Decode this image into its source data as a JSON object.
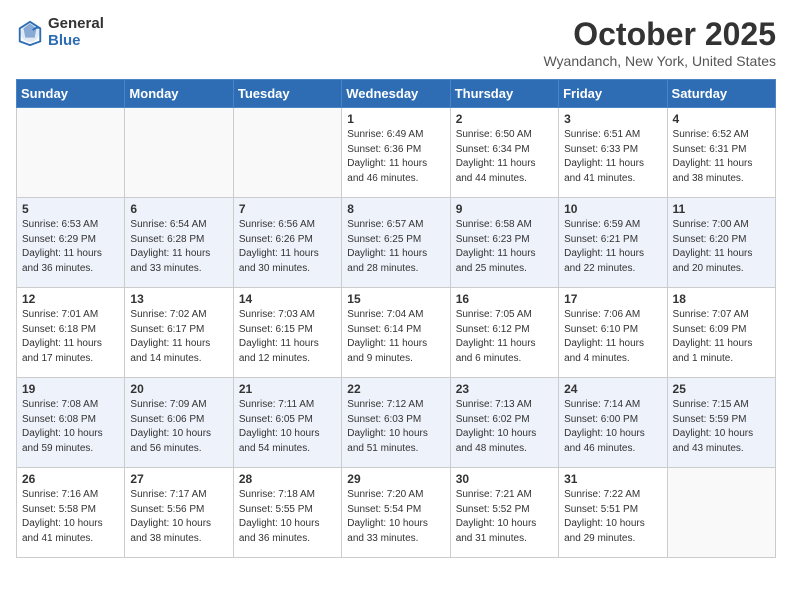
{
  "logo": {
    "general": "General",
    "blue": "Blue"
  },
  "title": "October 2025",
  "location": "Wyandanch, New York, United States",
  "days_of_week": [
    "Sunday",
    "Monday",
    "Tuesday",
    "Wednesday",
    "Thursday",
    "Friday",
    "Saturday"
  ],
  "weeks": [
    [
      {
        "day": "",
        "info": ""
      },
      {
        "day": "",
        "info": ""
      },
      {
        "day": "",
        "info": ""
      },
      {
        "day": "1",
        "info": "Sunrise: 6:49 AM\nSunset: 6:36 PM\nDaylight: 11 hours\nand 46 minutes."
      },
      {
        "day": "2",
        "info": "Sunrise: 6:50 AM\nSunset: 6:34 PM\nDaylight: 11 hours\nand 44 minutes."
      },
      {
        "day": "3",
        "info": "Sunrise: 6:51 AM\nSunset: 6:33 PM\nDaylight: 11 hours\nand 41 minutes."
      },
      {
        "day": "4",
        "info": "Sunrise: 6:52 AM\nSunset: 6:31 PM\nDaylight: 11 hours\nand 38 minutes."
      }
    ],
    [
      {
        "day": "5",
        "info": "Sunrise: 6:53 AM\nSunset: 6:29 PM\nDaylight: 11 hours\nand 36 minutes."
      },
      {
        "day": "6",
        "info": "Sunrise: 6:54 AM\nSunset: 6:28 PM\nDaylight: 11 hours\nand 33 minutes."
      },
      {
        "day": "7",
        "info": "Sunrise: 6:56 AM\nSunset: 6:26 PM\nDaylight: 11 hours\nand 30 minutes."
      },
      {
        "day": "8",
        "info": "Sunrise: 6:57 AM\nSunset: 6:25 PM\nDaylight: 11 hours\nand 28 minutes."
      },
      {
        "day": "9",
        "info": "Sunrise: 6:58 AM\nSunset: 6:23 PM\nDaylight: 11 hours\nand 25 minutes."
      },
      {
        "day": "10",
        "info": "Sunrise: 6:59 AM\nSunset: 6:21 PM\nDaylight: 11 hours\nand 22 minutes."
      },
      {
        "day": "11",
        "info": "Sunrise: 7:00 AM\nSunset: 6:20 PM\nDaylight: 11 hours\nand 20 minutes."
      }
    ],
    [
      {
        "day": "12",
        "info": "Sunrise: 7:01 AM\nSunset: 6:18 PM\nDaylight: 11 hours\nand 17 minutes."
      },
      {
        "day": "13",
        "info": "Sunrise: 7:02 AM\nSunset: 6:17 PM\nDaylight: 11 hours\nand 14 minutes."
      },
      {
        "day": "14",
        "info": "Sunrise: 7:03 AM\nSunset: 6:15 PM\nDaylight: 11 hours\nand 12 minutes."
      },
      {
        "day": "15",
        "info": "Sunrise: 7:04 AM\nSunset: 6:14 PM\nDaylight: 11 hours\nand 9 minutes."
      },
      {
        "day": "16",
        "info": "Sunrise: 7:05 AM\nSunset: 6:12 PM\nDaylight: 11 hours\nand 6 minutes."
      },
      {
        "day": "17",
        "info": "Sunrise: 7:06 AM\nSunset: 6:10 PM\nDaylight: 11 hours\nand 4 minutes."
      },
      {
        "day": "18",
        "info": "Sunrise: 7:07 AM\nSunset: 6:09 PM\nDaylight: 11 hours\nand 1 minute."
      }
    ],
    [
      {
        "day": "19",
        "info": "Sunrise: 7:08 AM\nSunset: 6:08 PM\nDaylight: 10 hours\nand 59 minutes."
      },
      {
        "day": "20",
        "info": "Sunrise: 7:09 AM\nSunset: 6:06 PM\nDaylight: 10 hours\nand 56 minutes."
      },
      {
        "day": "21",
        "info": "Sunrise: 7:11 AM\nSunset: 6:05 PM\nDaylight: 10 hours\nand 54 minutes."
      },
      {
        "day": "22",
        "info": "Sunrise: 7:12 AM\nSunset: 6:03 PM\nDaylight: 10 hours\nand 51 minutes."
      },
      {
        "day": "23",
        "info": "Sunrise: 7:13 AM\nSunset: 6:02 PM\nDaylight: 10 hours\nand 48 minutes."
      },
      {
        "day": "24",
        "info": "Sunrise: 7:14 AM\nSunset: 6:00 PM\nDaylight: 10 hours\nand 46 minutes."
      },
      {
        "day": "25",
        "info": "Sunrise: 7:15 AM\nSunset: 5:59 PM\nDaylight: 10 hours\nand 43 minutes."
      }
    ],
    [
      {
        "day": "26",
        "info": "Sunrise: 7:16 AM\nSunset: 5:58 PM\nDaylight: 10 hours\nand 41 minutes."
      },
      {
        "day": "27",
        "info": "Sunrise: 7:17 AM\nSunset: 5:56 PM\nDaylight: 10 hours\nand 38 minutes."
      },
      {
        "day": "28",
        "info": "Sunrise: 7:18 AM\nSunset: 5:55 PM\nDaylight: 10 hours\nand 36 minutes."
      },
      {
        "day": "29",
        "info": "Sunrise: 7:20 AM\nSunset: 5:54 PM\nDaylight: 10 hours\nand 33 minutes."
      },
      {
        "day": "30",
        "info": "Sunrise: 7:21 AM\nSunset: 5:52 PM\nDaylight: 10 hours\nand 31 minutes."
      },
      {
        "day": "31",
        "info": "Sunrise: 7:22 AM\nSunset: 5:51 PM\nDaylight: 10 hours\nand 29 minutes."
      },
      {
        "day": "",
        "info": ""
      }
    ]
  ]
}
